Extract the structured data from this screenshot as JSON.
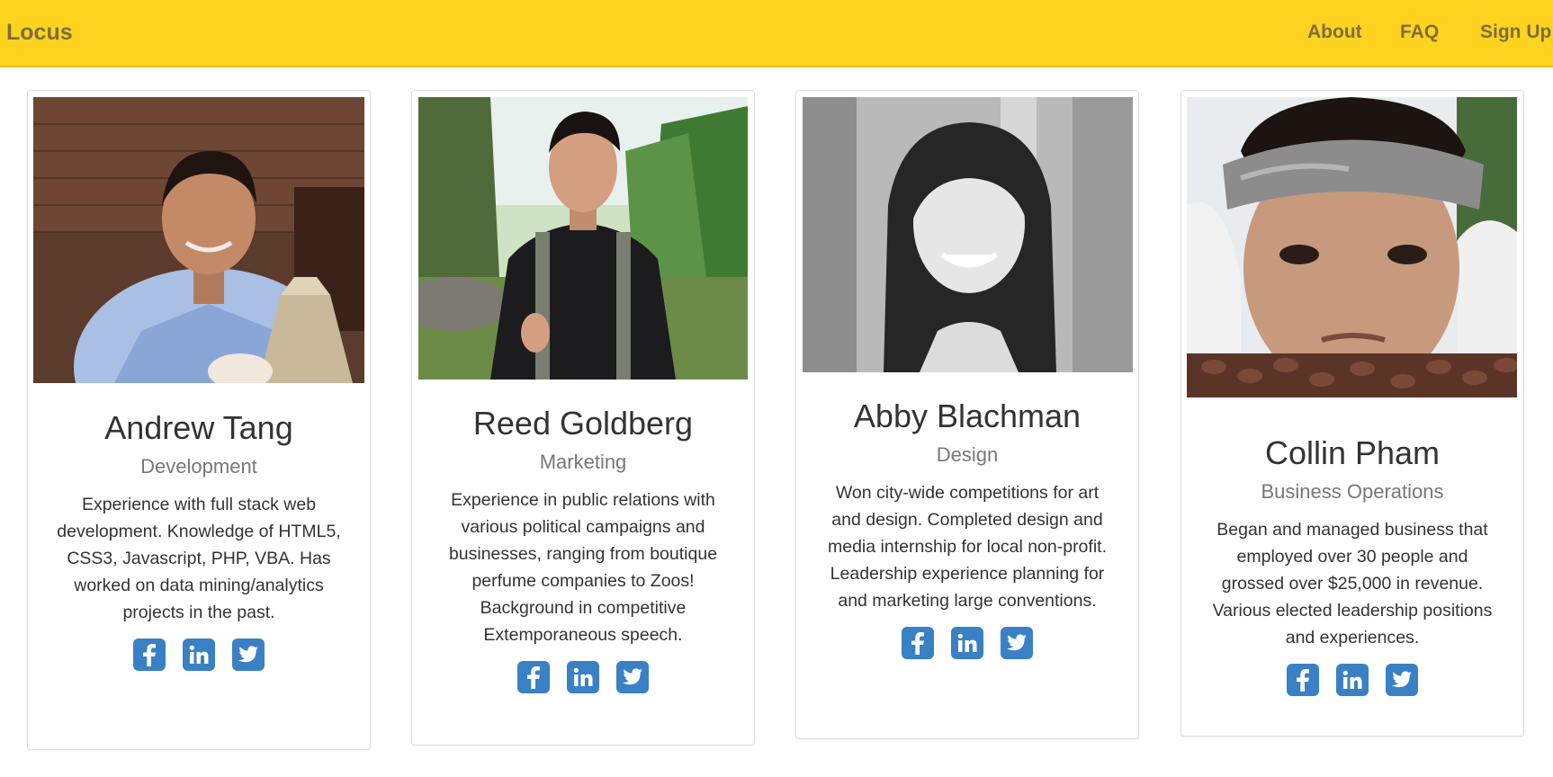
{
  "navbar": {
    "brand": "Locus",
    "links": [
      "About",
      "FAQ",
      "Sign Up"
    ],
    "bg_color": "#fed320",
    "text_color": "#7d6e3c"
  },
  "accent_color": "#3a80c5",
  "team": [
    {
      "name": "Andrew Tang",
      "role": "Development",
      "bio": "Experience with full stack web development. Knowledge of HTML5, CSS3, Javascript, PHP, VBA. Has worked on data mining/analytics projects in the past.",
      "socials": [
        "facebook-icon",
        "linkedin-icon",
        "twitter-icon"
      ]
    },
    {
      "name": "Reed Goldberg",
      "role": "Marketing",
      "bio": "Experience in public relations with various political campaigns and businesses, ranging from boutique perfume companies to Zoos! Background in competitive Extemporaneous speech.",
      "socials": [
        "facebook-icon",
        "linkedin-icon",
        "twitter-icon"
      ]
    },
    {
      "name": "Abby Blachman",
      "role": "Design",
      "bio": "Won city-wide competitions for art and design. Completed design and media internship for local non-profit. Leadership experience planning for and marketing large conventions.",
      "socials": [
        "facebook-icon",
        "linkedin-icon",
        "twitter-icon"
      ]
    },
    {
      "name": "Collin Pham",
      "role": "Business Operations",
      "bio": "Began and managed business that employed over 30 people and grossed over $25,000 in revenue. Various elected leadership positions and experiences.",
      "socials": [
        "facebook-icon",
        "linkedin-icon",
        "twitter-icon"
      ]
    }
  ]
}
